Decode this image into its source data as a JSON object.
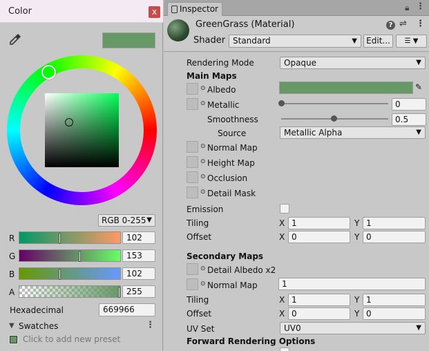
{
  "color_window": {
    "title": "Color",
    "close_glyph": "x",
    "preview_color": "#669966",
    "mode": "RGB 0-255",
    "channels": [
      {
        "label": "R",
        "value": "102"
      },
      {
        "label": "G",
        "value": "153"
      },
      {
        "label": "B",
        "value": "102"
      },
      {
        "label": "A",
        "value": "255"
      }
    ],
    "hex_label": "Hexadecimal",
    "hex_value": "669966",
    "swatches_label": "Swatches",
    "swatches_hint": "Click to add new preset",
    "icons": [
      "eyedropper-icon",
      "close-icon",
      "menu-dots-icon",
      "foldout-arrow-icon"
    ]
  },
  "inspector": {
    "tab_label": "Inspector",
    "material_name": "GreenGrass (Material)",
    "shader_label": "Shader",
    "shader_value": "Standard",
    "edit_label": "Edit...",
    "rendering_mode_label": "Rendering Mode",
    "rendering_mode_value": "Opaque",
    "main_maps_header": "Main Maps",
    "albedo_label": "Albedo",
    "albedo_color": "#669966",
    "metallic_label": "Metallic",
    "metallic_value": "0",
    "smoothness_label": "Smoothness",
    "smoothness_value": "0.5",
    "source_label": "Source",
    "source_value": "Metallic Alpha",
    "normal_map_label": "Normal Map",
    "height_map_label": "Height Map",
    "occlusion_label": "Occlusion",
    "detail_mask_label": "Detail Mask",
    "emission_label": "Emission",
    "tiling_label": "Tiling",
    "offset_label": "Offset",
    "x_label": "X",
    "y_label": "Y",
    "main_tiling": {
      "x": "1",
      "y": "1"
    },
    "main_offset": {
      "x": "0",
      "y": "0"
    },
    "secondary_maps_header": "Secondary Maps",
    "detail_albedo_label": "Detail Albedo x2",
    "secondary_normal_label": "Normal Map",
    "secondary_normal_value": "1",
    "secondary_tiling": {
      "x": "1",
      "y": "1"
    },
    "secondary_offset": {
      "x": "0",
      "y": "0"
    },
    "uv_set_label": "UV Set",
    "uv_set_value": "UV0",
    "forward_header": "Forward Rendering Options"
  }
}
